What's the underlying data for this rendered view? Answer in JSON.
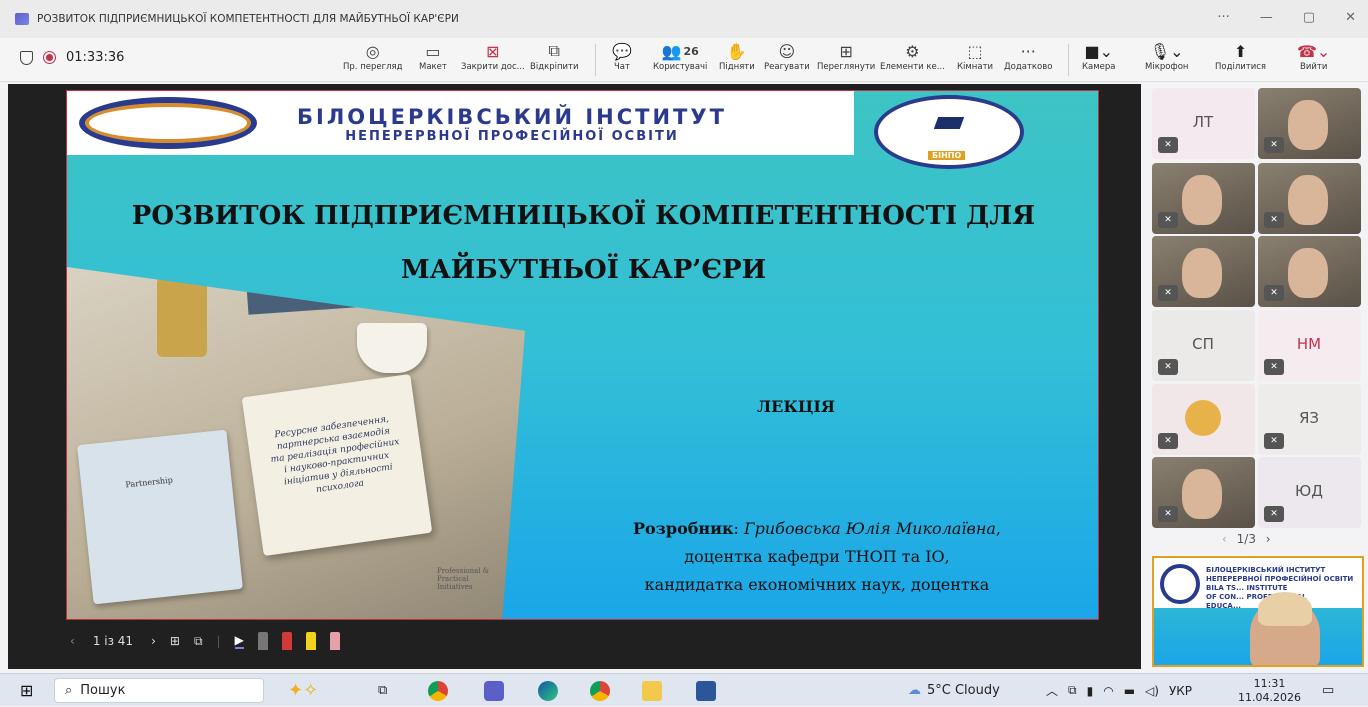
{
  "window": {
    "title": "РОЗВИТОК ПІДПРИЄМНИЦЬКОЇ КОМПЕТЕНТНОСТІ ДЛЯ МАЙБУТНЬОЇ КАР'ЄРИ",
    "controls": [
      "···",
      "—",
      "▢",
      "✕"
    ]
  },
  "meeting": {
    "recording_time": "01:33:36",
    "toolbar": [
      {
        "label": "Пр. перегляд",
        "icon": "eye-icon"
      },
      {
        "label": "Макет",
        "icon": "layout-icon"
      },
      {
        "label": "Закрити дос...",
        "icon": "close-share-icon"
      },
      {
        "label": "Відкріпити",
        "icon": "unpin-icon"
      },
      {
        "label": "Чат",
        "icon": "chat-icon"
      },
      {
        "label": "Користувачі",
        "icon": "people-icon",
        "count": "26"
      },
      {
        "label": "Підняти",
        "icon": "raise-hand-icon"
      },
      {
        "label": "Реагувати",
        "icon": "react-icon"
      },
      {
        "label": "Переглянути",
        "icon": "view-icon"
      },
      {
        "label": "Елементи ке...",
        "icon": "apps-icon"
      },
      {
        "label": "Кімнати",
        "icon": "rooms-icon"
      },
      {
        "label": "Додатково",
        "icon": "more-icon"
      },
      {
        "label": "Камера",
        "icon": "camera-icon"
      },
      {
        "label": "Мікрофон",
        "icon": "mic-icon"
      },
      {
        "label": "Поділитися",
        "icon": "share-icon"
      },
      {
        "label": "Вийти",
        "icon": "leave-icon"
      }
    ]
  },
  "slide": {
    "institute_line1": "БІЛОЦЕРКІВСЬКИЙ ІНСТИТУТ",
    "institute_line2": "НЕПЕРЕРВНОЇ ПРОФЕСІЙНОЇ ОСВІТИ",
    "badge": "БІНПО",
    "title_line1": "РОЗВИТОК ПІДПРИЄМНИЦЬКОЇ КОМПЕТЕНТНОСТІ ДЛЯ",
    "title_line2": "МАЙБУТНЬОЇ КАР’ЄРИ",
    "lecture": "ЛЕКЦІЯ",
    "author_label": "Розробник",
    "author_name": "Грибовська Юлія Миколаївна",
    "author_line2": "доцентка кафедри ТНОП та ІО,",
    "author_line3": "кандидатка економічних наук, доцентка",
    "notebook_text": "Ресурсне забезпечення, партнерська взаємодія та реалізація професійних і науково-практичних ініціатив у діяльності психолога",
    "clipboard_text": "Partnership",
    "professional_note": "Professional & Practical Initiatives"
  },
  "slide_nav": {
    "counter": "1 із 41"
  },
  "participants": [
    {
      "initials": "ЛТ",
      "video": false,
      "color": "#f4e9ee"
    },
    {
      "initials": "",
      "video": true
    },
    {
      "initials": "",
      "video": true
    },
    {
      "initials": "",
      "video": true
    },
    {
      "initials": "",
      "video": true
    },
    {
      "initials": "",
      "video": true
    },
    {
      "initials": "СП",
      "video": false,
      "color": "#ece9e9"
    },
    {
      "initials": "НМ",
      "video": false,
      "color": "#f5ecef",
      "fg": "#c4314b"
    },
    {
      "initials": "",
      "video": false,
      "avatar": true,
      "color": "#f1e6e8"
    },
    {
      "initials": "ЯЗ",
      "video": false,
      "color": "#eeecea"
    },
    {
      "initials": "",
      "video": true
    },
    {
      "initials": "ЮД",
      "video": false,
      "color": "#ece8ee"
    }
  ],
  "pager": "1/3",
  "mini_slide": {
    "line1": "БІЛОЦЕРКІВСЬКИЙ ІНСТИТУТ",
    "line2": "НЕПЕРЕРВНОЇ ПРОФЕСІЙНОЇ ОСВІТИ",
    "line3": "BILA TS... INSTITUTE",
    "line4": "OF CON... PROFESSIONAL",
    "line5": "EDUCA..."
  },
  "taskbar": {
    "search_placeholder": "Пошук",
    "weather": "5°C Cloudy",
    "language": "УКР",
    "time": "11:31",
    "date": "11.04.2026"
  }
}
